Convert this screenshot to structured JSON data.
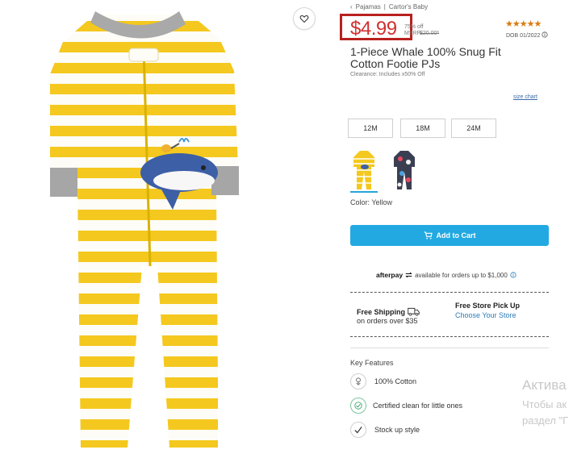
{
  "breadcrumb": {
    "back_glyph": "‹",
    "items": [
      "Pajamas",
      "Cartor's Baby"
    ]
  },
  "price": {
    "current": "$4.99",
    "percent_off": "75% off",
    "msrp_label": "MSRP",
    "msrp_value": "$20.00*"
  },
  "rating": {
    "stars": "★★★★★",
    "dob": "DOB 01/2022",
    "info_icon": "info-icon"
  },
  "product": {
    "title": "1-Piece Whale 100% Snug Fit Cotton Footie PJs",
    "clearance_note": "Clearance: Includes x50% Off",
    "size_chart": "size chart",
    "sizes": [
      "12M",
      "18M",
      "24M"
    ],
    "color_label": "Color: Yellow",
    "colors": {
      "accent": "#23a9e1",
      "price_red": "#d0302e",
      "star": "#d97a0c",
      "swatch_yellow": "#f4c81e"
    }
  },
  "cart": {
    "label": "Add to Cart",
    "icon": "cart-icon"
  },
  "afterpay": {
    "brand": "afterpay",
    "text": "available for orders up to $1,000"
  },
  "shipping": {
    "title": "Free Shipping",
    "sub": "on orders over $35",
    "icon": "truck-icon"
  },
  "store": {
    "title": "Free Store Pick Up",
    "link": "Choose Your Store"
  },
  "features": {
    "title": "Key Features",
    "items": [
      {
        "label": "100% Cotton",
        "icon": "cotton-icon"
      },
      {
        "label": "Certified clean for little ones",
        "icon": "certified-icon"
      },
      {
        "label": "Stock up style",
        "icon": "check-icon"
      }
    ]
  },
  "windows_watermark": {
    "title": "Актива",
    "line1": "Чтобы ак",
    "line2": "раздел \"Г"
  }
}
